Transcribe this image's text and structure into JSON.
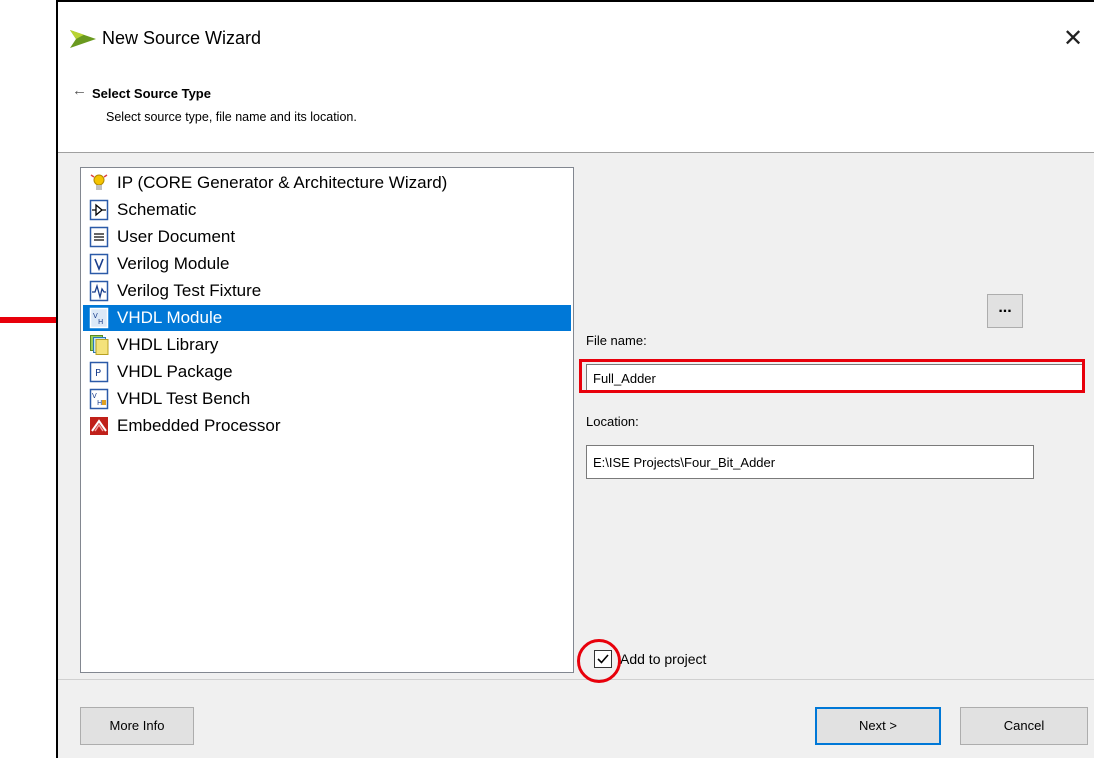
{
  "window": {
    "title": "New Source Wizard",
    "close_glyph": "✕"
  },
  "header": {
    "back_glyph": "←",
    "title": "Select Source Type",
    "subtitle": "Select source type, file name and its location."
  },
  "source_types": [
    {
      "label": "IP (CORE Generator & Architecture Wizard)",
      "icon": "ip-core-icon",
      "selected": false
    },
    {
      "label": "Schematic",
      "icon": "schematic-icon",
      "selected": false
    },
    {
      "label": "User Document",
      "icon": "user-document-icon",
      "selected": false
    },
    {
      "label": "Verilog Module",
      "icon": "verilog-module-icon",
      "selected": false
    },
    {
      "label": "Verilog Test Fixture",
      "icon": "verilog-test-fixture-icon",
      "selected": false
    },
    {
      "label": "VHDL Module",
      "icon": "vhdl-module-icon",
      "selected": true
    },
    {
      "label": "VHDL Library",
      "icon": "vhdl-library-icon",
      "selected": false
    },
    {
      "label": "VHDL Package",
      "icon": "vhdl-package-icon",
      "selected": false
    },
    {
      "label": "VHDL Test Bench",
      "icon": "vhdl-test-bench-icon",
      "selected": false
    },
    {
      "label": "Embedded Processor",
      "icon": "embedded-processor-icon",
      "selected": false
    }
  ],
  "form": {
    "file_name_label": "File name:",
    "file_name_value": "Full_Adder",
    "location_label": "Location:",
    "location_value": "E:\\ISE Projects\\Four_Bit_Adder",
    "browse_label": "...",
    "add_to_project_label": "Add to project",
    "add_to_project_checked": true
  },
  "footer": {
    "more_info_label": "More Info",
    "next_label": "Next >",
    "cancel_label": "Cancel"
  },
  "colors": {
    "selection": "#0078d7",
    "annotation": "#e8000b"
  }
}
